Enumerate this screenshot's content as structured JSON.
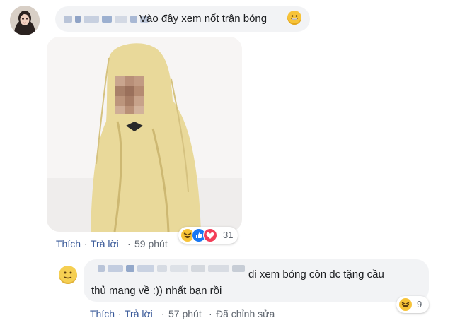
{
  "comment1": {
    "text": "Vào đây xem nốt trận bóng",
    "actions": {
      "like": "Thích",
      "reply": "Trả lời",
      "time": "59 phút",
      "separator": "·"
    },
    "reactions": {
      "count": "31",
      "icons": [
        "laugh-icon",
        "like-icon",
        "love-icon"
      ]
    }
  },
  "reply": {
    "line1": "đi xem bóng còn đc tặng cầu",
    "line2": "thủ mang về :)) nhất bạn rồi",
    "actions": {
      "like": "Thích",
      "reply": "Trả lời",
      "time": "57 phút",
      "edited": "Đã chỉnh sửa",
      "separator": "·"
    },
    "reactions": {
      "count": "9",
      "icons": [
        "laugh-icon"
      ]
    }
  },
  "colors": {
    "bubble": "#f2f3f5",
    "link": "#385898",
    "muted": "#606770",
    "text": "#1c1e21"
  }
}
